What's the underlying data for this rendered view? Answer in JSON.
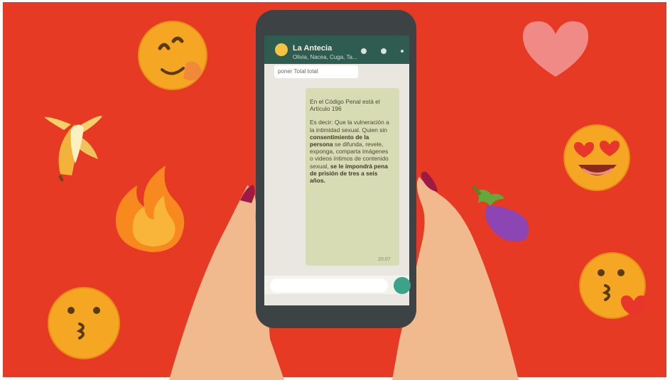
{
  "chat": {
    "contact_name": "La Antecia",
    "contact_subtitle": "Olivia, Nacea, Cuga, Ta...",
    "previous_message": "poner Total total",
    "message_intro": "En el Código Penal está el Artículo 196",
    "message_body_start": "Es decir: Que la vulneración a la intimidad sexual. Quien sin ",
    "message_body_bold_1": "consentimiento de la persona",
    "message_body_mid": " se difunda, revele, exponga, comparta imágenes o videos íntimos de contenido sexual, ",
    "message_body_bold_2": "se le impondrá pena de prisión de tres a seis años.",
    "message_time": "20:07"
  },
  "colors": {
    "background_red": "#e63a24",
    "phone_body": "#3d4344",
    "chat_header_green": "#2f5c50",
    "message_bubble": "#d8dcb4",
    "emoji_yellow": "#f5a623",
    "skin": "#f0b98e",
    "nail_polish": "#9e1a44"
  },
  "decorations": [
    "winking-emoji",
    "banana",
    "fire",
    "kissing-emoji",
    "heart",
    "heart-eyes-emoji",
    "eggplant",
    "kiss-heart-emoji"
  ]
}
